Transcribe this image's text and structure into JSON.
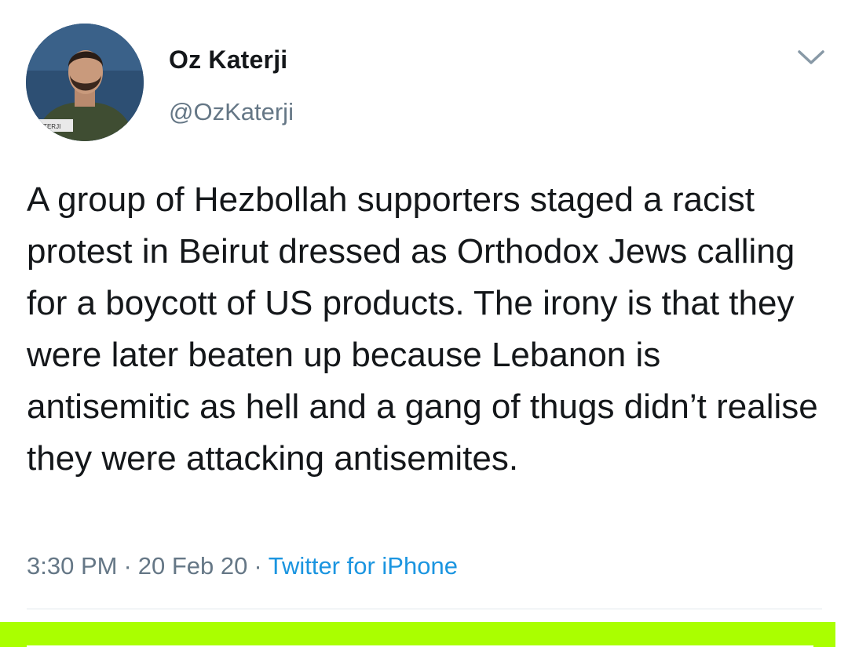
{
  "tweet": {
    "author": {
      "display_name": "Oz Katerji",
      "handle": "@OzKaterji",
      "avatar_caption": "KATERJI"
    },
    "text": "A group of Hezbollah supporters staged a racist protest in Beirut dressed as Orthodox Jews calling for a boycott of US products. The irony is that they were later beaten up because Lebanon is antisemitic as hell and a gang of thugs didn’t realise they were attacking antisemites.",
    "time": "3:30 PM",
    "date": "20 Feb 20",
    "separator": "·",
    "source": "Twitter for iPhone"
  },
  "colors": {
    "text": "#14171a",
    "secondary": "#657786",
    "link": "#1b95e0",
    "highlight": "#aaff00"
  },
  "icons": {
    "menu": "chevron-down-icon"
  }
}
